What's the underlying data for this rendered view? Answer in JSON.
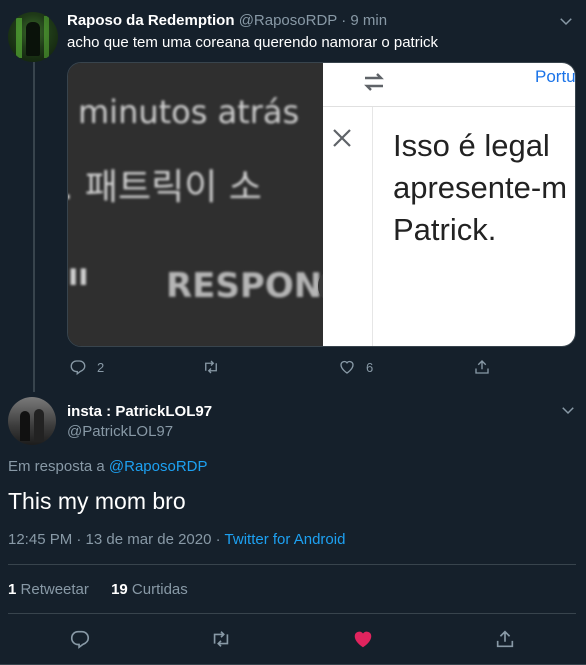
{
  "colors": {
    "background": "#15202b",
    "text": "#ffffff",
    "muted": "#8899a6",
    "link": "#1da1f2",
    "like": "#e0245e",
    "border": "#38444d"
  },
  "tweet1": {
    "display_name": "Raposo da Redemption",
    "handle": "@RaposoRDP",
    "time": "9 min",
    "dot": "·",
    "text": "acho que tem uma coreana querendo namorar o patrick",
    "media": {
      "left_line1": "minutos atrás",
      "left_line2": ". 패트릭이 소",
      "left_line3": "RESPON",
      "left_fragment": "ıı",
      "right_top_link": "Portu",
      "right_text_line1": "Isso é legal",
      "right_text_line2": "apresente-m",
      "right_text_line3": "Patrick."
    },
    "actions": {
      "reply_count": "2",
      "retweet_count": "",
      "like_count": "6"
    }
  },
  "tweet2": {
    "display_name": "insta : PatrickLOL97",
    "handle": "@PatrickLOL97",
    "reply_prefix": "Em resposta a",
    "reply_to": "@RaposoRDP",
    "text": "This my mom bro",
    "timestamp": "12:45 PM · 13 de mar de 2020 ·",
    "source": "Twitter for Android",
    "retweets_count": "1",
    "retweets_label": "Retweetar",
    "likes_count": "19",
    "likes_label": "Curtidas"
  },
  "icons": [
    "chevron-down-icon",
    "reply-icon",
    "retweet-icon",
    "heart-icon",
    "share-icon",
    "swap-icon",
    "close-icon"
  ]
}
